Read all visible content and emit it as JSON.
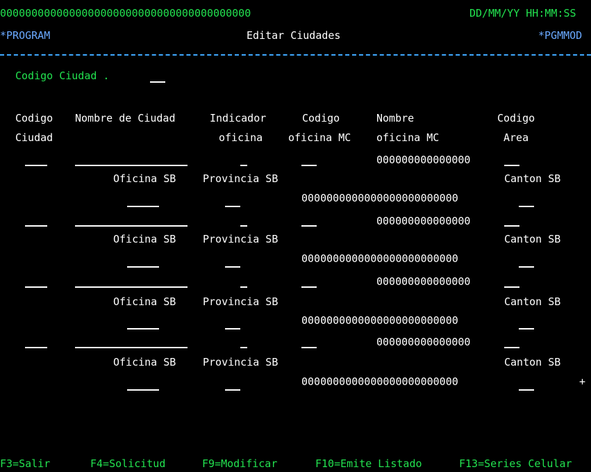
{
  "header": {
    "mask_left": "0000000000000000000000000000000000000000",
    "datetime": "DD/MM/YY HH:MM:SS",
    "program": "*PROGRAM",
    "title": "Editar Ciudades",
    "pgmmod": "*PGMMOD"
  },
  "filter": {
    "codigo_ciudad_label": "Codigo Ciudad ."
  },
  "columns": {
    "codigo_top": "Codigo",
    "codigo_bottom": "Ciudad",
    "nombre_ciudad": "Nombre de Ciudad",
    "indicador_top": "Indicador",
    "indicador_bottom": "oficina",
    "cod_oficina_top": "Codigo",
    "cod_oficina_bottom": "oficina MC",
    "nom_oficina_top": "Nombre",
    "nom_oficina_bottom": "oficina MC",
    "area_top": "Codigo",
    "area_bottom": "Area"
  },
  "records": [
    {
      "mask_nombre": "000000000000000",
      "oficina_sb": "Oficina SB",
      "provincia_sb": "Provincia SB",
      "canton_sb": "Canton SB",
      "mask_long": "0000000000000000000000000"
    },
    {
      "mask_nombre": "000000000000000",
      "oficina_sb": "Oficina SB",
      "provincia_sb": "Provincia SB",
      "canton_sb": "Canton SB",
      "mask_long": "0000000000000000000000000"
    },
    {
      "mask_nombre": "000000000000000",
      "oficina_sb": "Oficina SB",
      "provincia_sb": "Provincia SB",
      "canton_sb": "Canton SB",
      "mask_long": "0000000000000000000000000"
    },
    {
      "mask_nombre": "000000000000000",
      "oficina_sb": "Oficina SB",
      "provincia_sb": "Provincia SB",
      "canton_sb": "Canton SB",
      "mask_long": "0000000000000000000000000"
    }
  ],
  "more_indicator": "+",
  "function_keys": [
    "F3=Salir",
    "F4=Solicitud",
    "F9=Modificar",
    "F10=Emite Listado",
    "F13=Series Celular"
  ]
}
